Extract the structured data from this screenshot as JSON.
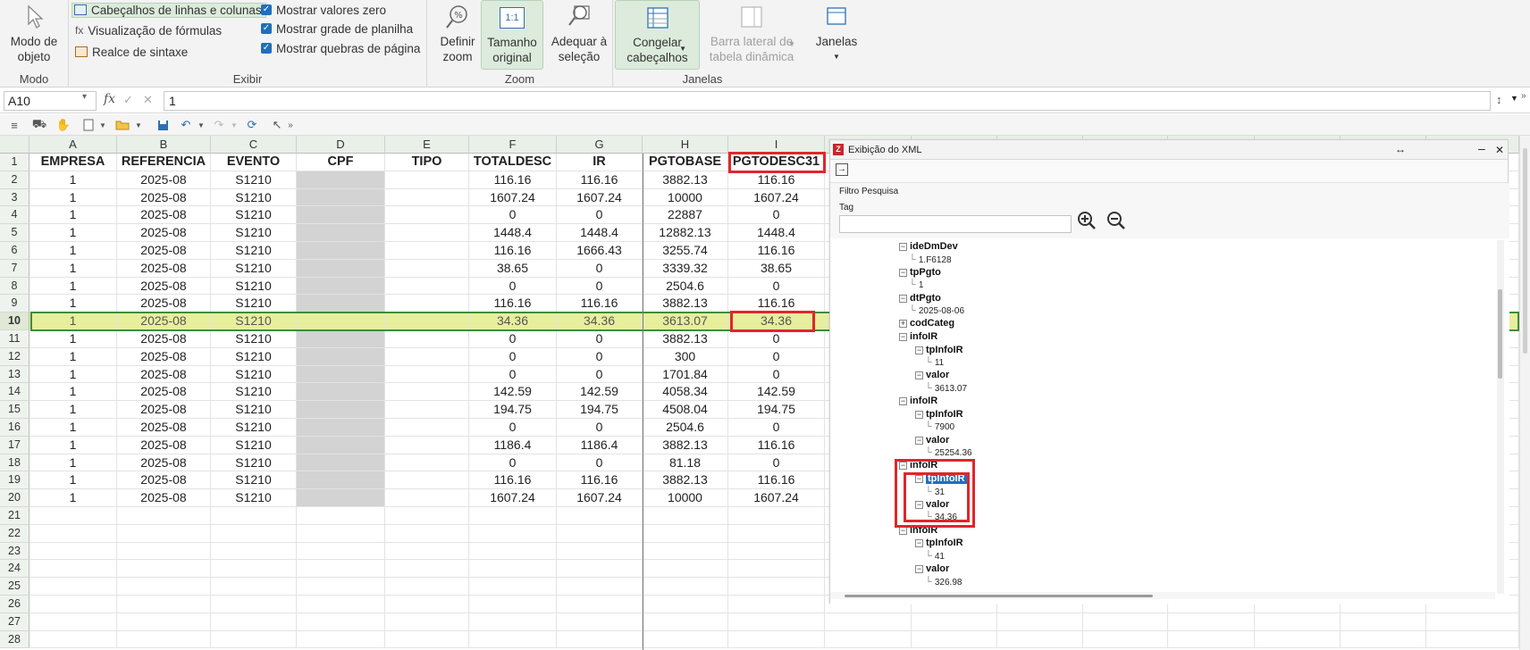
{
  "ribbon": {
    "modo": {
      "button_label": "Modo de objeto",
      "group_label": "Modo"
    },
    "exibir": {
      "group_label": "Exibir",
      "row_col_headers": "Cabeçalhos de linhas e colunas",
      "formula_view": "Visualização de fórmulas",
      "syntax_highlight": "Realce de sintaxe",
      "show_zero": "Mostrar valores zero",
      "show_grid": "Mostrar grade de planilha",
      "show_page_breaks": "Mostrar quebras de página"
    },
    "zoom": {
      "group_label": "Zoom",
      "define_zoom": "Definir zoom",
      "original_size": "Tamanho original",
      "fit_selection": "Adequar à seleção",
      "icon_text": "1:1"
    },
    "janelas": {
      "group_label": "Janelas",
      "freeze": "Congelar cabeçalhos",
      "pivot_sidebar": "Barra lateral de tabela dinâmica",
      "windows": "Janelas"
    }
  },
  "formula_bar": {
    "name_box": "A10",
    "fx": "fx",
    "value": "1"
  },
  "sheet": {
    "columns": [
      "A",
      "B",
      "C",
      "D",
      "E",
      "F",
      "G",
      "H",
      "I"
    ],
    "headers": [
      "EMPRESA",
      "REFERENCIA",
      "EVENTO",
      "CPF",
      "TIPO",
      "TOTALDESC",
      "IR",
      "PGTOBASE",
      "PGTODESC31"
    ],
    "rows": [
      [
        "1",
        "2025-08",
        "S1210",
        "",
        "",
        "116.16",
        "116.16",
        "3882.13",
        "116.16"
      ],
      [
        "1",
        "2025-08",
        "S1210",
        "",
        "",
        "1607.24",
        "1607.24",
        "10000",
        "1607.24"
      ],
      [
        "1",
        "2025-08",
        "S1210",
        "",
        "",
        "0",
        "0",
        "22887",
        "0"
      ],
      [
        "1",
        "2025-08",
        "S1210",
        "",
        "",
        "1448.4",
        "1448.4",
        "12882.13",
        "1448.4"
      ],
      [
        "1",
        "2025-08",
        "S1210",
        "",
        "",
        "116.16",
        "1666.43",
        "3255.74",
        "116.16"
      ],
      [
        "1",
        "2025-08",
        "S1210",
        "",
        "",
        "38.65",
        "0",
        "3339.32",
        "38.65"
      ],
      [
        "1",
        "2025-08",
        "S1210",
        "",
        "",
        "0",
        "0",
        "2504.6",
        "0"
      ],
      [
        "1",
        "2025-08",
        "S1210",
        "",
        "",
        "116.16",
        "116.16",
        "3882.13",
        "116.16"
      ],
      [
        "1",
        "2025-08",
        "S1210",
        "",
        "",
        "34.36",
        "34.36",
        "3613.07",
        "34.36"
      ],
      [
        "1",
        "2025-08",
        "S1210",
        "",
        "",
        "0",
        "0",
        "3882.13",
        "0"
      ],
      [
        "1",
        "2025-08",
        "S1210",
        "",
        "",
        "0",
        "0",
        "300",
        "0"
      ],
      [
        "1",
        "2025-08",
        "S1210",
        "",
        "",
        "0",
        "0",
        "1701.84",
        "0"
      ],
      [
        "1",
        "2025-08",
        "S1210",
        "",
        "",
        "142.59",
        "142.59",
        "4058.34",
        "142.59"
      ],
      [
        "1",
        "2025-08",
        "S1210",
        "",
        "",
        "194.75",
        "194.75",
        "4508.04",
        "194.75"
      ],
      [
        "1",
        "2025-08",
        "S1210",
        "",
        "",
        "0",
        "0",
        "2504.6",
        "0"
      ],
      [
        "1",
        "2025-08",
        "S1210",
        "",
        "",
        "1186.4",
        "1186.4",
        "3882.13",
        "116.16"
      ],
      [
        "1",
        "2025-08",
        "S1210",
        "",
        "",
        "0",
        "0",
        "81.18",
        "0"
      ],
      [
        "1",
        "2025-08",
        "S1210",
        "",
        "",
        "116.16",
        "116.16",
        "3882.13",
        "116.16"
      ],
      [
        "1",
        "2025-08",
        "S1210",
        "",
        "",
        "1607.24",
        "1607.24",
        "10000",
        "1607.24"
      ]
    ],
    "row_numbers": [
      "1",
      "2",
      "3",
      "4",
      "5",
      "6",
      "7",
      "8",
      "9",
      "10",
      "11",
      "12",
      "13",
      "14",
      "15",
      "16",
      "17",
      "18",
      "19",
      "20",
      "21",
      "22",
      "23",
      "24",
      "25",
      "26",
      "27",
      "28"
    ],
    "selected_row": "10"
  },
  "xml_panel": {
    "title": "Exibição do XML",
    "filter_label": "Filtro Pesquisa",
    "tag_label": "Tag",
    "tag_value": "",
    "tree": [
      {
        "kind": "node",
        "name": "ideDmDev",
        "box": "−"
      },
      {
        "kind": "value",
        "text": "1.F6128"
      },
      {
        "kind": "node",
        "name": "tpPgto",
        "box": "−"
      },
      {
        "kind": "value",
        "text": "1"
      },
      {
        "kind": "node",
        "name": "dtPgto",
        "box": "−"
      },
      {
        "kind": "value",
        "text": "2025-08-06"
      },
      {
        "kind": "node",
        "name": "codCateg",
        "box": "+"
      },
      {
        "kind": "node",
        "name": "infoIR",
        "box": "−"
      },
      {
        "kind": "child",
        "name": "tpInfoIR"
      },
      {
        "kind": "cvalue",
        "text": "11"
      },
      {
        "kind": "child",
        "name": "valor"
      },
      {
        "kind": "cvalue",
        "text": "3613.07"
      },
      {
        "kind": "node",
        "name": "infoIR",
        "box": "−"
      },
      {
        "kind": "child",
        "name": "tpInfoIR"
      },
      {
        "kind": "cvalue",
        "text": "7900"
      },
      {
        "kind": "child",
        "name": "valor"
      },
      {
        "kind": "cvalue",
        "text": "25254.36"
      },
      {
        "kind": "node",
        "name": "infoIR",
        "box": "−"
      },
      {
        "kind": "child",
        "name": "tpInfoIR",
        "selected": true
      },
      {
        "kind": "cvalue",
        "text": "31"
      },
      {
        "kind": "child",
        "name": "valor"
      },
      {
        "kind": "cvalue",
        "text": "34.36"
      },
      {
        "kind": "node",
        "name": "infoIR",
        "box": "−"
      },
      {
        "kind": "child",
        "name": "tpInfoIR"
      },
      {
        "kind": "cvalue",
        "text": "41"
      },
      {
        "kind": "child",
        "name": "valor"
      },
      {
        "kind": "cvalue",
        "text": "326.98"
      }
    ]
  },
  "colors": {
    "highlight_row": "#e7ef9d",
    "red_box": "#e0262b",
    "accent": "#1f6fbf",
    "masked": "#d3d3d3"
  }
}
